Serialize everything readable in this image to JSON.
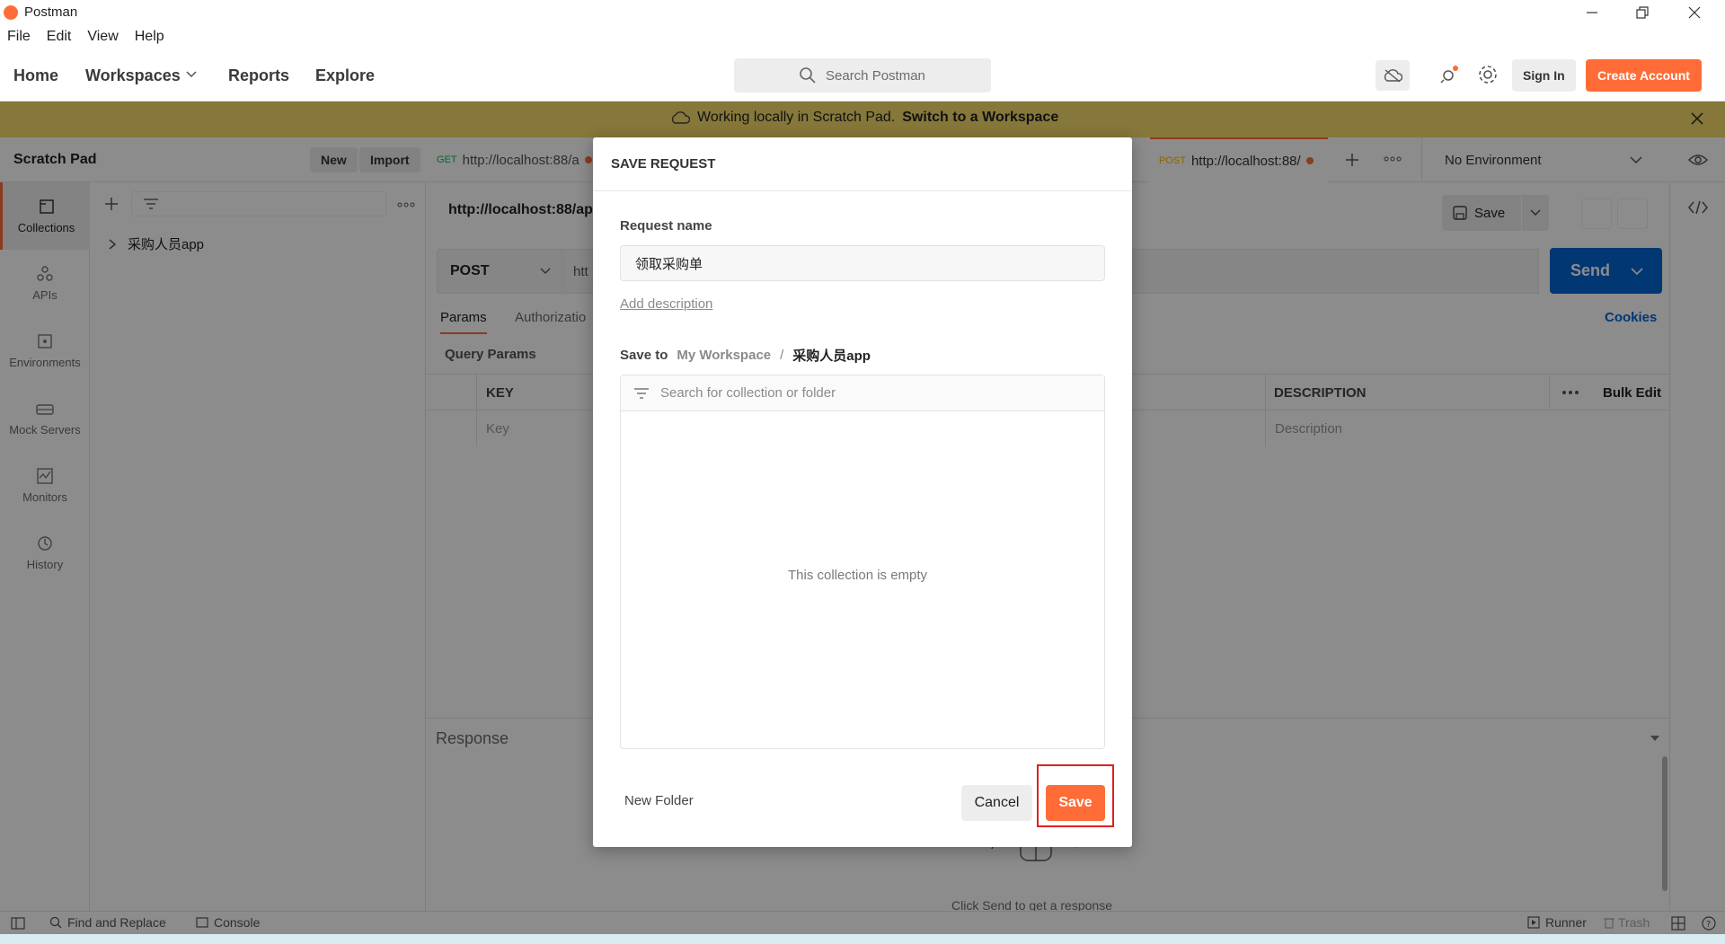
{
  "window": {
    "app_name": "Postman",
    "controls": [
      "minimize-icon",
      "restore-icon",
      "close-icon"
    ]
  },
  "menu": [
    "File",
    "Edit",
    "View",
    "Help"
  ],
  "header": {
    "nav": [
      "Home",
      "Workspaces",
      "Reports",
      "Explore"
    ],
    "search_placeholder": "Search Postman",
    "sign_in": "Sign In",
    "create_account": "Create Account",
    "accent": "#ff6c37"
  },
  "banner": {
    "text": "Working locally in Scratch Pad.",
    "link": "Switch to a Workspace"
  },
  "scratchpad": {
    "title": "Scratch Pad",
    "new_label": "New",
    "import_label": "Import"
  },
  "tabs": [
    {
      "method": "GET",
      "url": "http://localhost:88/a"
    },
    {
      "method": "POST",
      "url": "http://localhost:88/"
    }
  ],
  "environment": {
    "selected": "No Environment"
  },
  "left_nav": [
    "Collections",
    "APIs",
    "Environments",
    "Mock Servers",
    "Monitors",
    "History"
  ],
  "sidebar": {
    "collections": [
      "采购人员app"
    ]
  },
  "request": {
    "url_title": "http://localhost:88/ap",
    "method": "POST",
    "url_value": "htt",
    "save_label": "Save",
    "send_label": "Send",
    "tabs": [
      "Params",
      "Authorizatio"
    ],
    "cookies": "Cookies",
    "query_params_title": "Query Params",
    "table": {
      "headers": [
        "KEY",
        "DESCRIPTION"
      ],
      "bulk_edit": "Bulk Edit",
      "key_placeholder": "Key",
      "description_placeholder": "Description"
    }
  },
  "response": {
    "title": "Response",
    "hint": "Click Send to get a response"
  },
  "statusbar": {
    "find_replace": "Find and Replace",
    "console": "Console",
    "runner": "Runner",
    "trash": "Trash"
  },
  "modal": {
    "title": "SAVE REQUEST",
    "request_name_label": "Request name",
    "request_name_value": "领取采购单",
    "add_description": "Add description",
    "save_to_label": "Save to",
    "save_to_workspace": "My Workspace",
    "save_to_separator": "/",
    "save_to_collection": "采购人员app",
    "search_placeholder": "Search for collection or folder",
    "empty_text": "This collection is empty",
    "new_folder": "New Folder",
    "cancel": "Cancel",
    "save": "Save"
  }
}
